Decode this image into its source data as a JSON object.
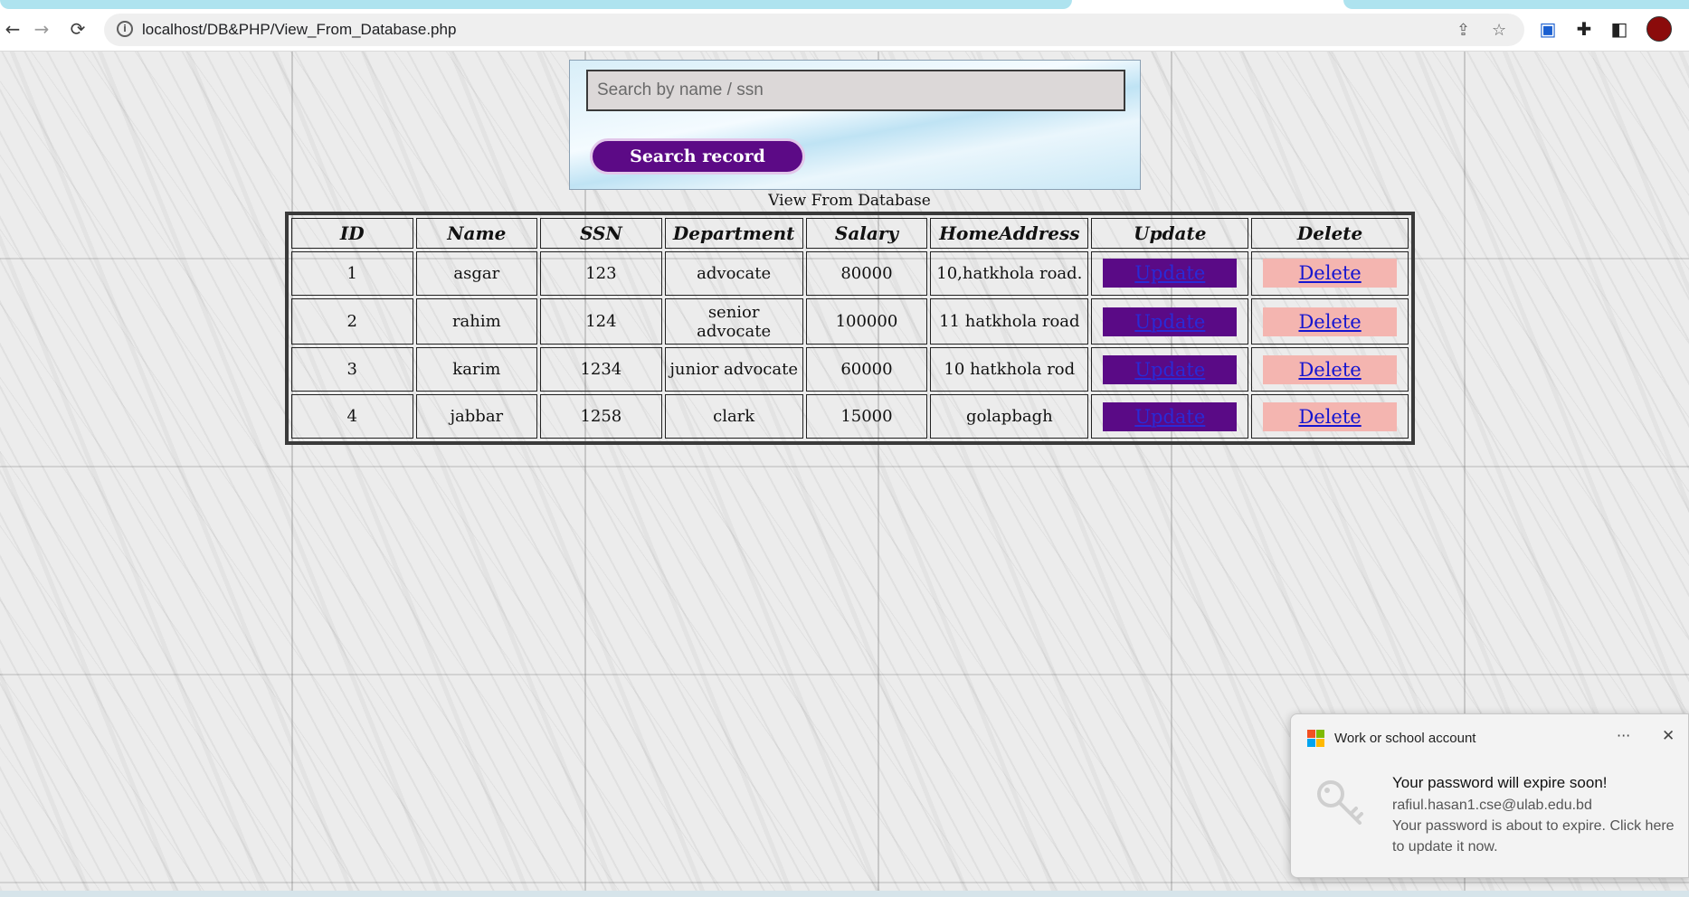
{
  "browser": {
    "back_icon": "arrow-left-icon",
    "forward_icon": "arrow-right-icon",
    "reload_icon": "reload-icon",
    "url": "localhost/DB&PHP/View_From_Database.php",
    "share_icon": "share-icon",
    "bookmark_icon": "star-icon",
    "extensions_icon": "puzzle-icon",
    "sidepanel_icon": "side-panel-icon"
  },
  "search": {
    "placeholder": "Search by name / ssn",
    "button_label": "Search record"
  },
  "caption": "View From Database",
  "table": {
    "headers": [
      "ID",
      "Name",
      "SSN",
      "Department",
      "Salary",
      "HomeAddress",
      "Update",
      "Delete"
    ],
    "rows": [
      {
        "id": "1",
        "name": "asgar",
        "ssn": "123",
        "department": "advocate",
        "salary": "80000",
        "address": "10,hatkhola road.",
        "update": "Update",
        "delete": "Delete"
      },
      {
        "id": "2",
        "name": "rahim",
        "ssn": "124",
        "department": "senior advocate",
        "salary": "100000",
        "address": "11 hatkhola road",
        "update": "Update",
        "delete": "Delete"
      },
      {
        "id": "3",
        "name": "karim",
        "ssn": "1234",
        "department": "junior advocate",
        "salary": "60000",
        "address": "10 hatkhola rod",
        "update": "Update",
        "delete": "Delete"
      },
      {
        "id": "4",
        "name": "jabbar",
        "ssn": "1258",
        "department": "clark",
        "salary": "15000",
        "address": "golapbagh",
        "update": "Update",
        "delete": "Delete"
      }
    ]
  },
  "toast": {
    "app_name": "Work or school account",
    "more": "···",
    "title": "Your password will expire soon!",
    "email": "rafiul.hasan1.cse@ulab.edu.bd",
    "message": "Your password is about to expire. Click here to update it now."
  },
  "colors": {
    "update_bg": "#5a0a86",
    "delete_bg": "#f4b5b0",
    "search_button_bg": "#5c0a86"
  }
}
